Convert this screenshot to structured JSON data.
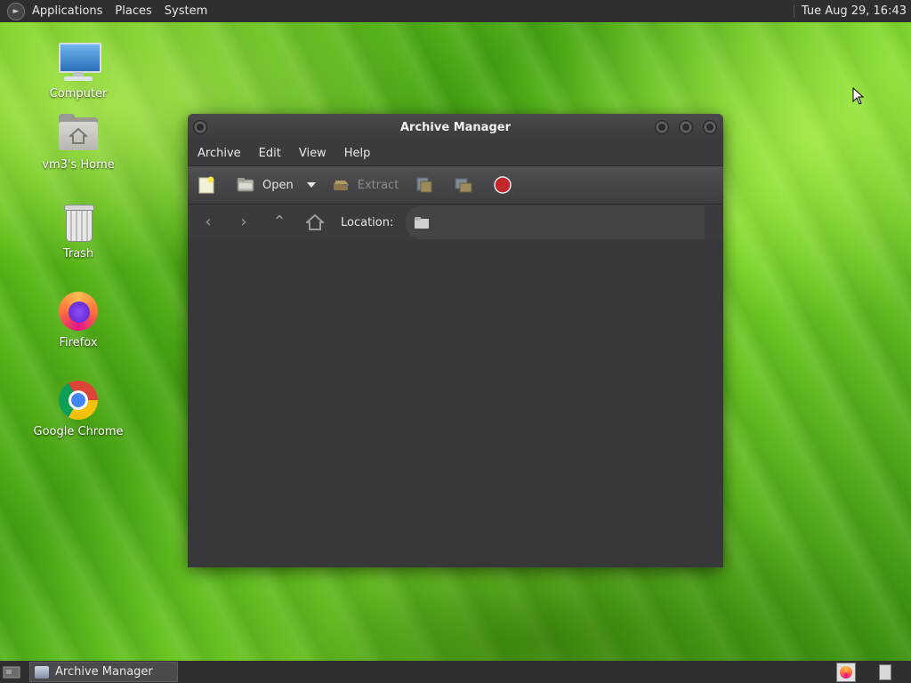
{
  "top_panel": {
    "menus": [
      "Applications",
      "Places",
      "System"
    ],
    "clock": "Tue Aug 29, 16:43"
  },
  "desktop": {
    "icons": [
      {
        "label": "Computer",
        "icon": "computer-icon"
      },
      {
        "label": "vm3's Home",
        "icon": "home-folder-icon"
      },
      {
        "label": "Trash",
        "icon": "trash-icon"
      },
      {
        "label": "Firefox",
        "icon": "firefox-icon"
      },
      {
        "label": "Google Chrome",
        "icon": "chrome-icon"
      }
    ]
  },
  "window": {
    "title": "Archive Manager",
    "menubar": [
      "Archive",
      "Edit",
      "View",
      "Help"
    ],
    "toolbar": {
      "new_icon": "new-archive-icon",
      "open_label": "Open",
      "extract_label": "Extract",
      "add_files_icon": "add-files-icon",
      "add_folder_icon": "add-folder-icon",
      "stop_icon": "stop-icon"
    },
    "location_bar": {
      "label": "Location:",
      "back_icon": "back-icon",
      "forward_icon": "forward-icon",
      "up_icon": "up-icon",
      "home_icon": "home-icon"
    }
  },
  "bottom_panel": {
    "task_label": "Archive Manager"
  },
  "colors": {
    "panel_bg": "#2f2f31",
    "window_bg": "#3b3b3d",
    "desktop_green": "#5cbf1f",
    "stop_red": "#c0262c"
  }
}
